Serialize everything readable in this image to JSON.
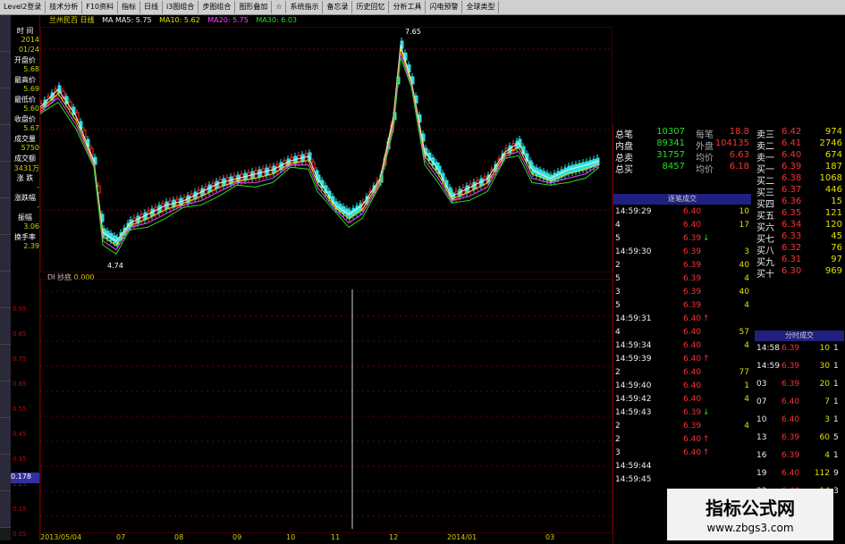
{
  "toolbar": {
    "buttons": [
      "Level2登录",
      "技术分析",
      "F10资料",
      "指标",
      "日线",
      "i3图组合",
      "步图组合",
      "图形叠加",
      "☆",
      "系统指示",
      "备忘录",
      "历史回忆",
      "分析工具",
      "闪电预警",
      "全球类型"
    ]
  },
  "info_line": {
    "title": "兰州民百 日线",
    "ma5": "MA MA5: 5.75",
    "ma10": "MA10: 5.62",
    "ma20": "MA20: 5.75",
    "ma30": "MA30: 6.03"
  },
  "left_panel": {
    "rows": [
      {
        "label": "时 间",
        "value": "2014"
      },
      {
        "label": "",
        "value": "01/24"
      },
      {
        "label": "开盘价",
        "value": "5.68"
      },
      {
        "label": "最高价",
        "value": "5.69"
      },
      {
        "label": "最低价",
        "value": "5.60"
      },
      {
        "label": "收盘价",
        "value": "5.67"
      },
      {
        "label": "成交量",
        "value": "5750"
      },
      {
        "label": "成交额",
        "value": "3431万"
      },
      {
        "label": "涨 跌",
        "value": "-"
      },
      {
        "label": "涨跌幅",
        "value": "-"
      },
      {
        "label": "振幅",
        "value": "3.06"
      },
      {
        "label": "换手率",
        "value": "2.39"
      }
    ],
    "scale": [
      "0.95",
      "0.85",
      "0.75",
      "0.65",
      "0.55",
      "0.45",
      "0.35",
      "0.25",
      "0.15",
      "0.05"
    ],
    "current_value": "0.178"
  },
  "chart": {
    "low_label": "4.74",
    "high_label": "7.65"
  },
  "indicator": {
    "name": "DI 抄底",
    "value": "0.000"
  },
  "xaxis": [
    "2013/05/04",
    "07",
    "08",
    "09",
    "10",
    "11",
    "12",
    "2014/01",
    "03"
  ],
  "right_panel": {
    "summary": [
      {
        "l1": "总笔",
        "v1": "10307",
        "l2": "每笔",
        "v2": "18.8"
      },
      {
        "l1": "内盘",
        "v1": "89341",
        "l2": "外盘",
        "v2": "104135"
      },
      {
        "l1": "总卖",
        "v1": "31757",
        "l2": "均价",
        "v2": "6.63"
      },
      {
        "l1": "总买",
        "v1": "8457",
        "l2": "均价",
        "v2": "6.18"
      }
    ],
    "asks": [
      {
        "label": "卖三",
        "price": "6.42",
        "vol": "974"
      },
      {
        "label": "卖二",
        "price": "6.41",
        "vol": "2746"
      },
      {
        "label": "卖一",
        "price": "6.40",
        "vol": "674"
      }
    ],
    "bids": [
      {
        "label": "买一",
        "price": "6.39",
        "vol": "187"
      },
      {
        "label": "买二",
        "price": "6.38",
        "vol": "1068"
      },
      {
        "label": "买三",
        "price": "6.37",
        "vol": "446"
      },
      {
        "label": "买四",
        "price": "6.36",
        "vol": "15"
      },
      {
        "label": "买五",
        "price": "6.35",
        "vol": "121"
      },
      {
        "label": "买六",
        "price": "6.34",
        "vol": "120"
      },
      {
        "label": "买七",
        "price": "6.33",
        "vol": "45"
      },
      {
        "label": "买八",
        "price": "6.32",
        "vol": "76"
      },
      {
        "label": "买九",
        "price": "6.31",
        "vol": "97"
      },
      {
        "label": "买十",
        "price": "6.30",
        "vol": "969"
      }
    ],
    "deal_header": "逐笔成交",
    "deals": [
      {
        "time": "14:59:29",
        "price": "6.40",
        "vol": "10",
        "dir": ""
      },
      {
        "time": "4",
        "price": "6.40",
        "vol": "17",
        "dir": ""
      },
      {
        "time": "5",
        "price": "6.39",
        "vol": "",
        "dir": "↓"
      },
      {
        "time": "14:59:30",
        "price": "6.39",
        "vol": "3",
        "dir": ""
      },
      {
        "time": "2",
        "price": "6.39",
        "vol": "40",
        "dir": ""
      },
      {
        "time": "5",
        "price": "6.39",
        "vol": "4",
        "dir": ""
      },
      {
        "time": "3",
        "price": "6.39",
        "vol": "40",
        "dir": ""
      },
      {
        "time": "5",
        "price": "6.39",
        "vol": "4",
        "dir": ""
      },
      {
        "time": "14:59:31",
        "price": "6.40",
        "vol": "",
        "dir": "↑"
      },
      {
        "time": "4",
        "price": "6.40",
        "vol": "57",
        "dir": ""
      },
      {
        "time": "14:59:34",
        "price": "6.40",
        "vol": "4",
        "dir": ""
      },
      {
        "time": "14:59:39",
        "price": "6.40",
        "vol": "",
        "dir": "↑"
      },
      {
        "time": "2",
        "price": "6.40",
        "vol": "77",
        "dir": ""
      },
      {
        "time": "14:59:40",
        "price": "6.40",
        "vol": "1",
        "dir": ""
      },
      {
        "time": "14:59:42",
        "price": "6.40",
        "vol": "4",
        "dir": ""
      },
      {
        "time": "14:59:43",
        "price": "6.39",
        "vol": "",
        "dir": "↓"
      },
      {
        "time": "2",
        "price": "6.39",
        "vol": "4",
        "dir": ""
      },
      {
        "time": "2",
        "price": "6.40",
        "vol": "",
        "dir": "↑"
      },
      {
        "time": "3",
        "price": "6.40",
        "vol": "",
        "dir": "↑"
      },
      {
        "time": "14:59:44",
        "price": "",
        "vol": "",
        "dir": ""
      },
      {
        "time": "14:59:45",
        "price": "",
        "vol": "",
        "dir": ""
      }
    ],
    "minute_header": "分时成交",
    "minutes": [
      {
        "time": "14:58",
        "price": "6.39",
        "vol": "10",
        "n": "1"
      },
      {
        "time": "14:59",
        "price": "6.39",
        "vol": "30",
        "n": "1"
      },
      {
        "time": "03",
        "price": "6.39",
        "vol": "20",
        "n": "1"
      },
      {
        "time": "07",
        "price": "6.40",
        "vol": "7",
        "n": "1"
      },
      {
        "time": "10",
        "price": "6.40",
        "vol": "3",
        "n": "1"
      },
      {
        "time": "13",
        "price": "6.39",
        "vol": "60",
        "n": "5"
      },
      {
        "time": "16",
        "price": "6.39",
        "vol": "4",
        "n": "1"
      },
      {
        "time": "19",
        "price": "6.40",
        "vol": "112",
        "n": "9"
      },
      {
        "time": "22",
        "price": "6.40",
        "vol": "14",
        "n": "3"
      }
    ]
  },
  "watermark": {
    "line1": "指标公式网",
    "line2": "www.zbgs3.com"
  },
  "colors": {
    "up": "#ff3030",
    "down": "#30e0e0",
    "ma5": "#eeeeee",
    "ma10": "#e0e000",
    "ma20": "#ff40ff",
    "ma30": "#20e020",
    "grid": "#700000"
  }
}
